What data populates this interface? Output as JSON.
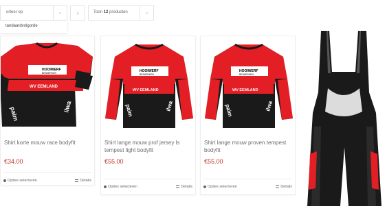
{
  "toolbar": {
    "sort_value": "orteer op",
    "sort_dropdown_option": "tandaardvolgorde",
    "order_icon": "arrow-down-icon",
    "count_prefix": "Toon",
    "count_number": "12",
    "count_suffix": "producten"
  },
  "colors": {
    "price": "#c0392b",
    "jersey_red": "#e31e24",
    "jersey_black": "#1a1a1a"
  },
  "jersey_texts": {
    "sponsor": "HOOIWERF",
    "sponsor_line2": "BEIWERKEN",
    "club": "WV EEMLAND"
  },
  "products": [
    {
      "title": "Shirt korte mouw race bodyfit",
      "price": "€34.00",
      "options_label": "Opties selecteren",
      "details_label": "Details"
    },
    {
      "title": "Shirt lange mouw prof jersey ls tempest light bodyfit",
      "price": "€55.00",
      "options_label": "Opties selecteren",
      "details_label": "Details"
    },
    {
      "title": "Shirt lange mouw proven tempest bodyfit",
      "price": "€55.00",
      "options_label": "Opties selecteren",
      "details_label": "Details"
    }
  ]
}
